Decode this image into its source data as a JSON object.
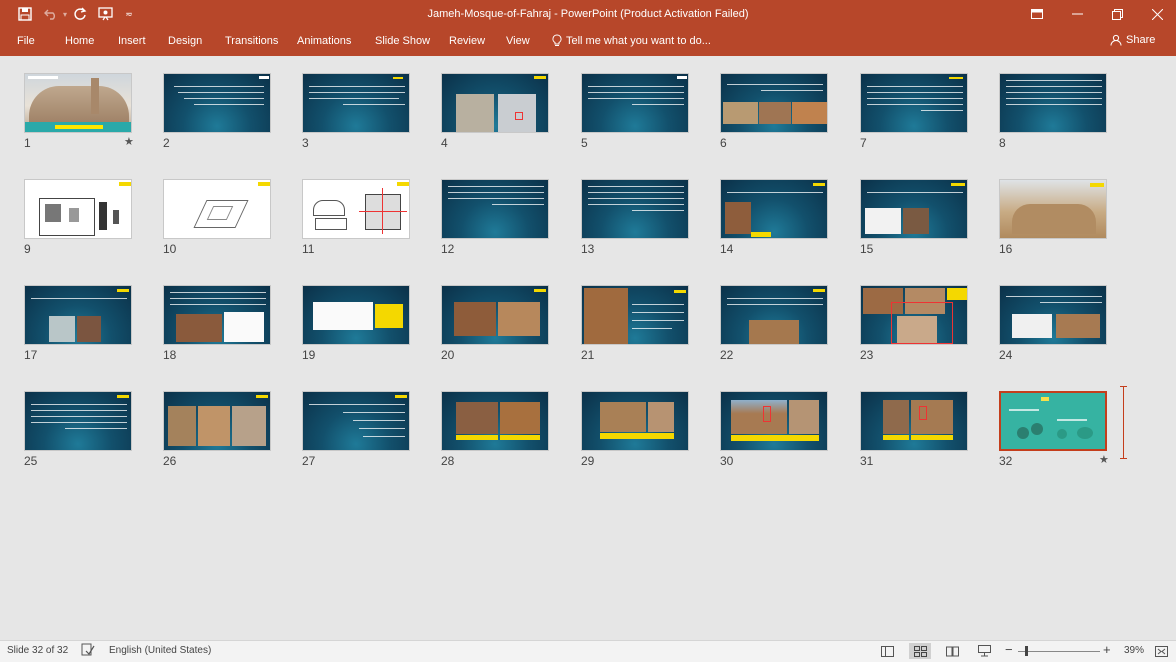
{
  "window": {
    "title": "Jameh-Mosque-of-Fahraj  -  PowerPoint (Product Activation Failed)",
    "accent": "#b7472a"
  },
  "qat": {
    "save_icon": "save-icon",
    "undo_icon": "undo-icon",
    "redo_icon": "redo-icon",
    "present_icon": "present-from-beginning-icon",
    "customize_icon": "customize-qat-icon"
  },
  "ribbon": {
    "tabs": [
      "File",
      "Home",
      "Insert",
      "Design",
      "Transitions",
      "Animations",
      "Slide Show",
      "Review",
      "View"
    ],
    "tell_me": "Tell me what you want to do...",
    "share": "Share"
  },
  "slides": [
    {
      "num": "1",
      "star": "★"
    },
    {
      "num": "2",
      "star": ""
    },
    {
      "num": "3",
      "star": ""
    },
    {
      "num": "4",
      "star": ""
    },
    {
      "num": "5",
      "star": ""
    },
    {
      "num": "6",
      "star": ""
    },
    {
      "num": "7",
      "star": ""
    },
    {
      "num": "8",
      "star": ""
    },
    {
      "num": "9",
      "star": ""
    },
    {
      "num": "10",
      "star": ""
    },
    {
      "num": "11",
      "star": ""
    },
    {
      "num": "12",
      "star": ""
    },
    {
      "num": "13",
      "star": ""
    },
    {
      "num": "14",
      "star": ""
    },
    {
      "num": "15",
      "star": ""
    },
    {
      "num": "16",
      "star": ""
    },
    {
      "num": "17",
      "star": ""
    },
    {
      "num": "18",
      "star": ""
    },
    {
      "num": "19",
      "star": ""
    },
    {
      "num": "20",
      "star": ""
    },
    {
      "num": "21",
      "star": ""
    },
    {
      "num": "22",
      "star": ""
    },
    {
      "num": "23",
      "star": ""
    },
    {
      "num": "24",
      "star": ""
    },
    {
      "num": "25",
      "star": ""
    },
    {
      "num": "26",
      "star": ""
    },
    {
      "num": "27",
      "star": ""
    },
    {
      "num": "28",
      "star": ""
    },
    {
      "num": "29",
      "star": ""
    },
    {
      "num": "30",
      "star": ""
    },
    {
      "num": "31",
      "star": ""
    },
    {
      "num": "32",
      "star": "★"
    }
  ],
  "status": {
    "slide_info": "Slide 32 of 32",
    "language": "English (United States)",
    "zoom": "39%",
    "zoom_out": "−",
    "zoom_in": "+"
  }
}
